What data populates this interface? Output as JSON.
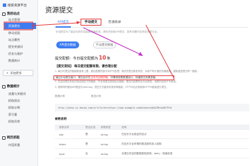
{
  "sidebar": {
    "header": "搜索资源平台",
    "groups": [
      {
        "title": "我的站点",
        "items": [
          "站点管理",
          "资源提交",
          "移动适配",
          "站点属性",
          "提交关键词",
          "优化与维护",
          "数据统计"
        ]
      },
      {
        "title": "数据统计",
        "items": [
          "流量与关键词",
          "抓取频次",
          "抓取诊断",
          "索引量",
          "抓取异常"
        ]
      },
      {
        "title": "网页抓取",
        "items": [
          "内容质量"
        ]
      }
    ],
    "active": "资源提交",
    "add_button": "添加更多"
  },
  "page": {
    "title": "资源提交",
    "tabs": [
      "API提交",
      "手动提交",
      "普通收录"
    ],
    "description": "手动提交为了保证优质内容能被快速收录，请优先使用API提交，如有问题可反馈至资源平台。",
    "subtabs": [
      "API提交数据",
      "手动提交数据"
    ],
    "quota_prefix": "提交配额：今日提交配额为",
    "quota_number": "10",
    "quota_suffix": "条",
    "notice_title": "【提交须知】 每日提交配额有限，请合理分配",
    "para1": "1. 每日可提交的链接数量有上限，超出配额的部分将不予处理；请优先提交新发布的、对用户有价值的页面链接，避免重复提交同一链接。",
    "highlight_prefix": "通过手动提交接口，提交后可在",
    "highlight_red": "当天内加快抓取",
    "highlight_suffix": "，详情请查看数据统计，快速提交效果显著。",
    "para2": "2. 仅支持提交本站已验证域名下的链接，不支持提交其他站点链接；提交内容需符合平台规范，违规内容将不予收录。",
    "para3": "3. 推荐同时使用API推送与sitemap，提交方式越多收录效率越高，HTTPS站点请使用HTTPS链接进行提交。",
    "example_labels": [
      "数据示例",
      "推送示例"
    ],
    "code": "http://data.zz.baidu.com/urls?site=https://www.example.com&token=A6d2ZMrbu8ET9fd",
    "section_title": "参数说明",
    "table_headers": [
      "参数名称",
      "是否必选",
      "参数类型",
      "说明"
    ],
    "table_rows": [
      [
        "site",
        "是",
        "string",
        "在站长平台验证的站点"
      ],
      [
        "token",
        "是",
        "string",
        "在站长平台申请的推送用的准入密钥"
      ],
      [
        "type",
        "否",
        "string",
        "对提交内容的数据类型说明，daily：快速收录"
      ]
    ]
  }
}
